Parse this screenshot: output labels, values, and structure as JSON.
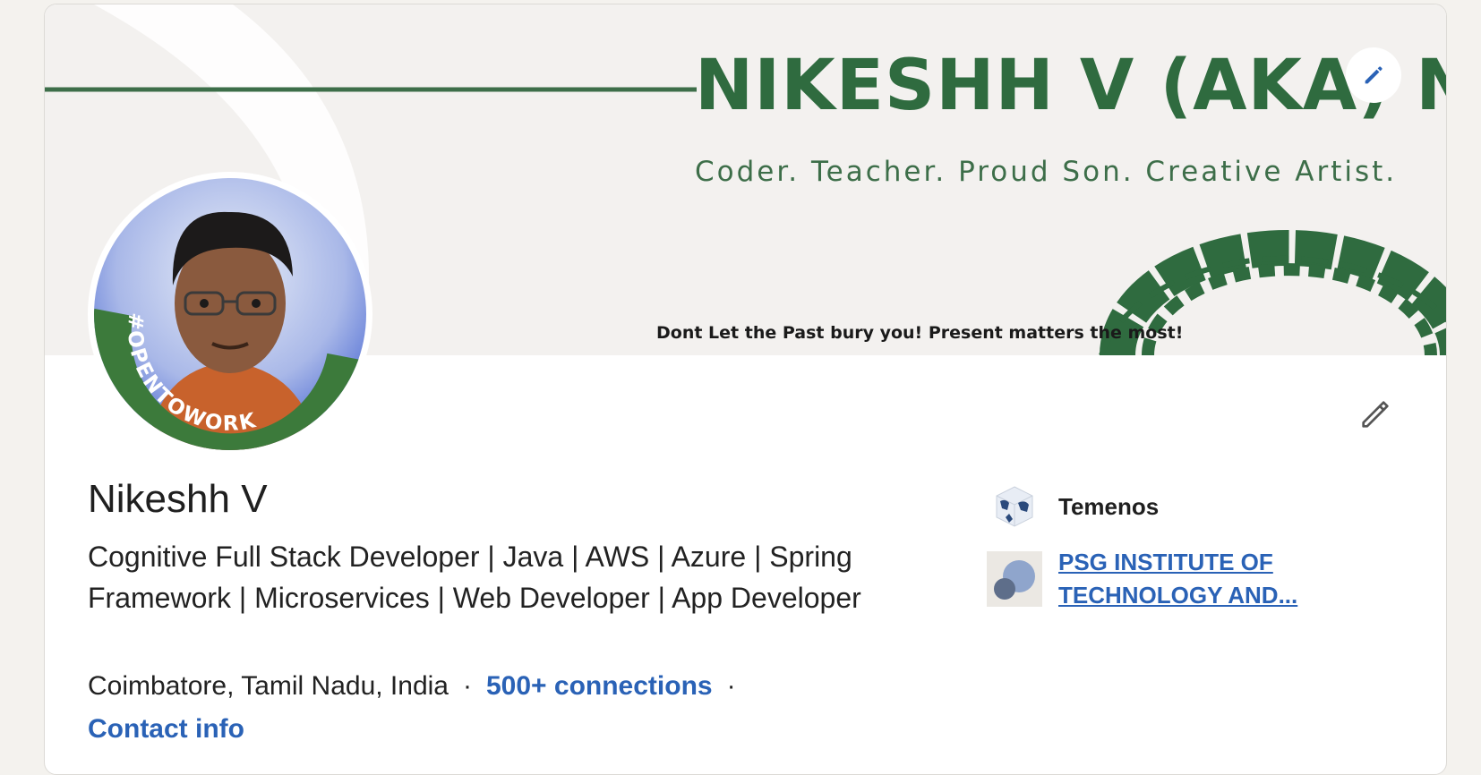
{
  "banner": {
    "title": "NIKESHH V  (AKA) NIK",
    "subtitle": "Coder. Teacher. Proud Son. Creative Artist.",
    "quote": "Dont Let the Past bury you! Present matters the most!",
    "edit_icon": "pencil-icon",
    "colors": {
      "brand_green": "#2f6b3f",
      "background": "#f3f1ef"
    }
  },
  "avatar": {
    "badge_text": "#OPENTOWORK",
    "badge_color": "#3c7a3b"
  },
  "profile": {
    "name": "Nikeshh V",
    "headline": "Cognitive Full Stack Developer | Java | AWS | Azure | Spring Framework | Microservices | Web Developer | App Developer",
    "location": "Coimbatore, Tamil Nadu, India",
    "separator": "·",
    "connections": "500+ connections",
    "contact_info": "Contact info",
    "edit_icon": "pencil-icon",
    "link_color": "#2a62b6"
  },
  "organizations": [
    {
      "name": "Temenos",
      "logo_icon": "globe-cube-icon"
    },
    {
      "name": "PSG INSTITUTE OF TECHNOLOGY AND...",
      "logo_icon": "circles-logo-icon"
    }
  ]
}
